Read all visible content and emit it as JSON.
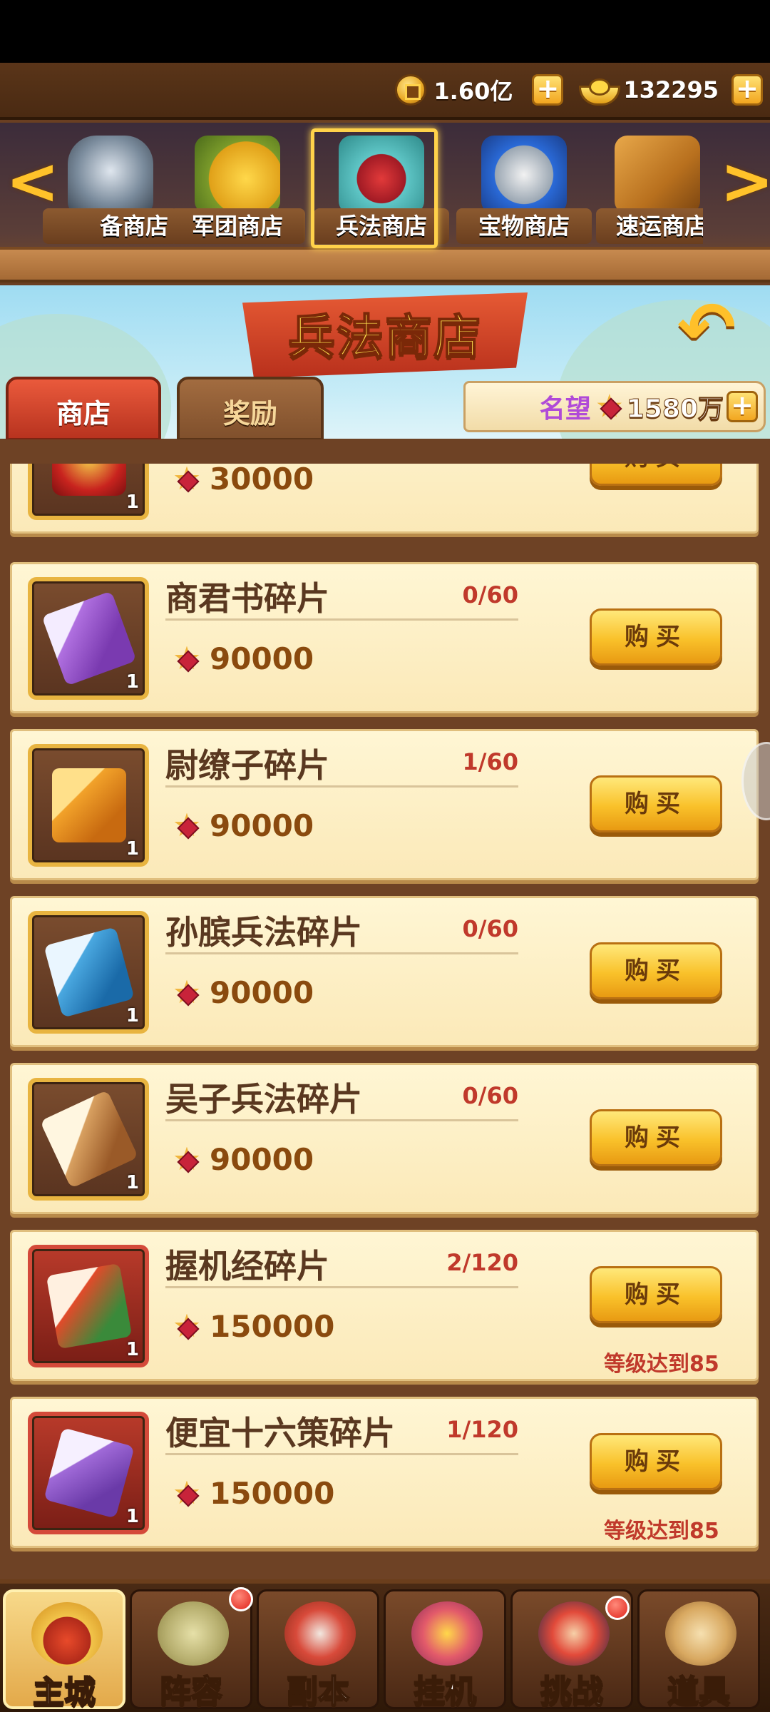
{
  "currency": {
    "copper_value": "1.60亿",
    "gold_value": "132295",
    "plus_symbol": "+"
  },
  "store_tabs": [
    {
      "label": "备商店",
      "active": false
    },
    {
      "label": "军团商店",
      "active": false
    },
    {
      "label": "兵法商店",
      "active": true
    },
    {
      "label": "宝物商店",
      "active": false
    },
    {
      "label": "速运商店",
      "active": false
    }
  ],
  "arrows": {
    "left": "<",
    "right": ">"
  },
  "header": {
    "title": "兵法商店",
    "back_symbol": "↶",
    "tab_shop": "商店",
    "tab_reward": "奖励",
    "fame_label": "名望",
    "fame_value": "1580万"
  },
  "items": [
    {
      "name": "",
      "ratio": "",
      "price": "30000",
      "buy": "购买",
      "level_req": "",
      "thumb": "gold",
      "icon": "red-tome-icon"
    },
    {
      "name": "商君书碎片",
      "ratio": "0/60",
      "price": "90000",
      "buy": "购买",
      "level_req": "",
      "thumb": "gold",
      "icon": "purple-scroll-icon"
    },
    {
      "name": "尉缭子碎片",
      "ratio": "1/60",
      "price": "90000",
      "buy": "购买",
      "level_req": "",
      "thumb": "gold",
      "icon": "orange-scroll-icon"
    },
    {
      "name": "孙膑兵法碎片",
      "ratio": "0/60",
      "price": "90000",
      "buy": "购买",
      "level_req": "",
      "thumb": "gold",
      "icon": "blue-scroll-icon"
    },
    {
      "name": "吴子兵法碎片",
      "ratio": "0/60",
      "price": "90000",
      "buy": "购买",
      "level_req": "",
      "thumb": "gold",
      "icon": "bamboo-scroll-icon"
    },
    {
      "name": "握机经碎片",
      "ratio": "2/120",
      "price": "150000",
      "buy": "购买",
      "level_req": "等级达到85",
      "thumb": "red",
      "icon": "red-scroll-icon"
    },
    {
      "name": "便宜十六策碎片",
      "ratio": "1/120",
      "price": "150000",
      "buy": "购买",
      "level_req": "等级达到85",
      "thumb": "red",
      "icon": "violet-scroll-icon"
    }
  ],
  "item_count": "1",
  "nav": [
    {
      "label": "主城",
      "active": true,
      "badge": false
    },
    {
      "label": "阵容",
      "active": false,
      "badge": true
    },
    {
      "label": "副本",
      "active": false,
      "badge": false
    },
    {
      "label": "挂机",
      "active": false,
      "badge": false
    },
    {
      "label": "挑战",
      "active": false,
      "badge": true
    },
    {
      "label": "道具",
      "active": false,
      "badge": false
    }
  ]
}
